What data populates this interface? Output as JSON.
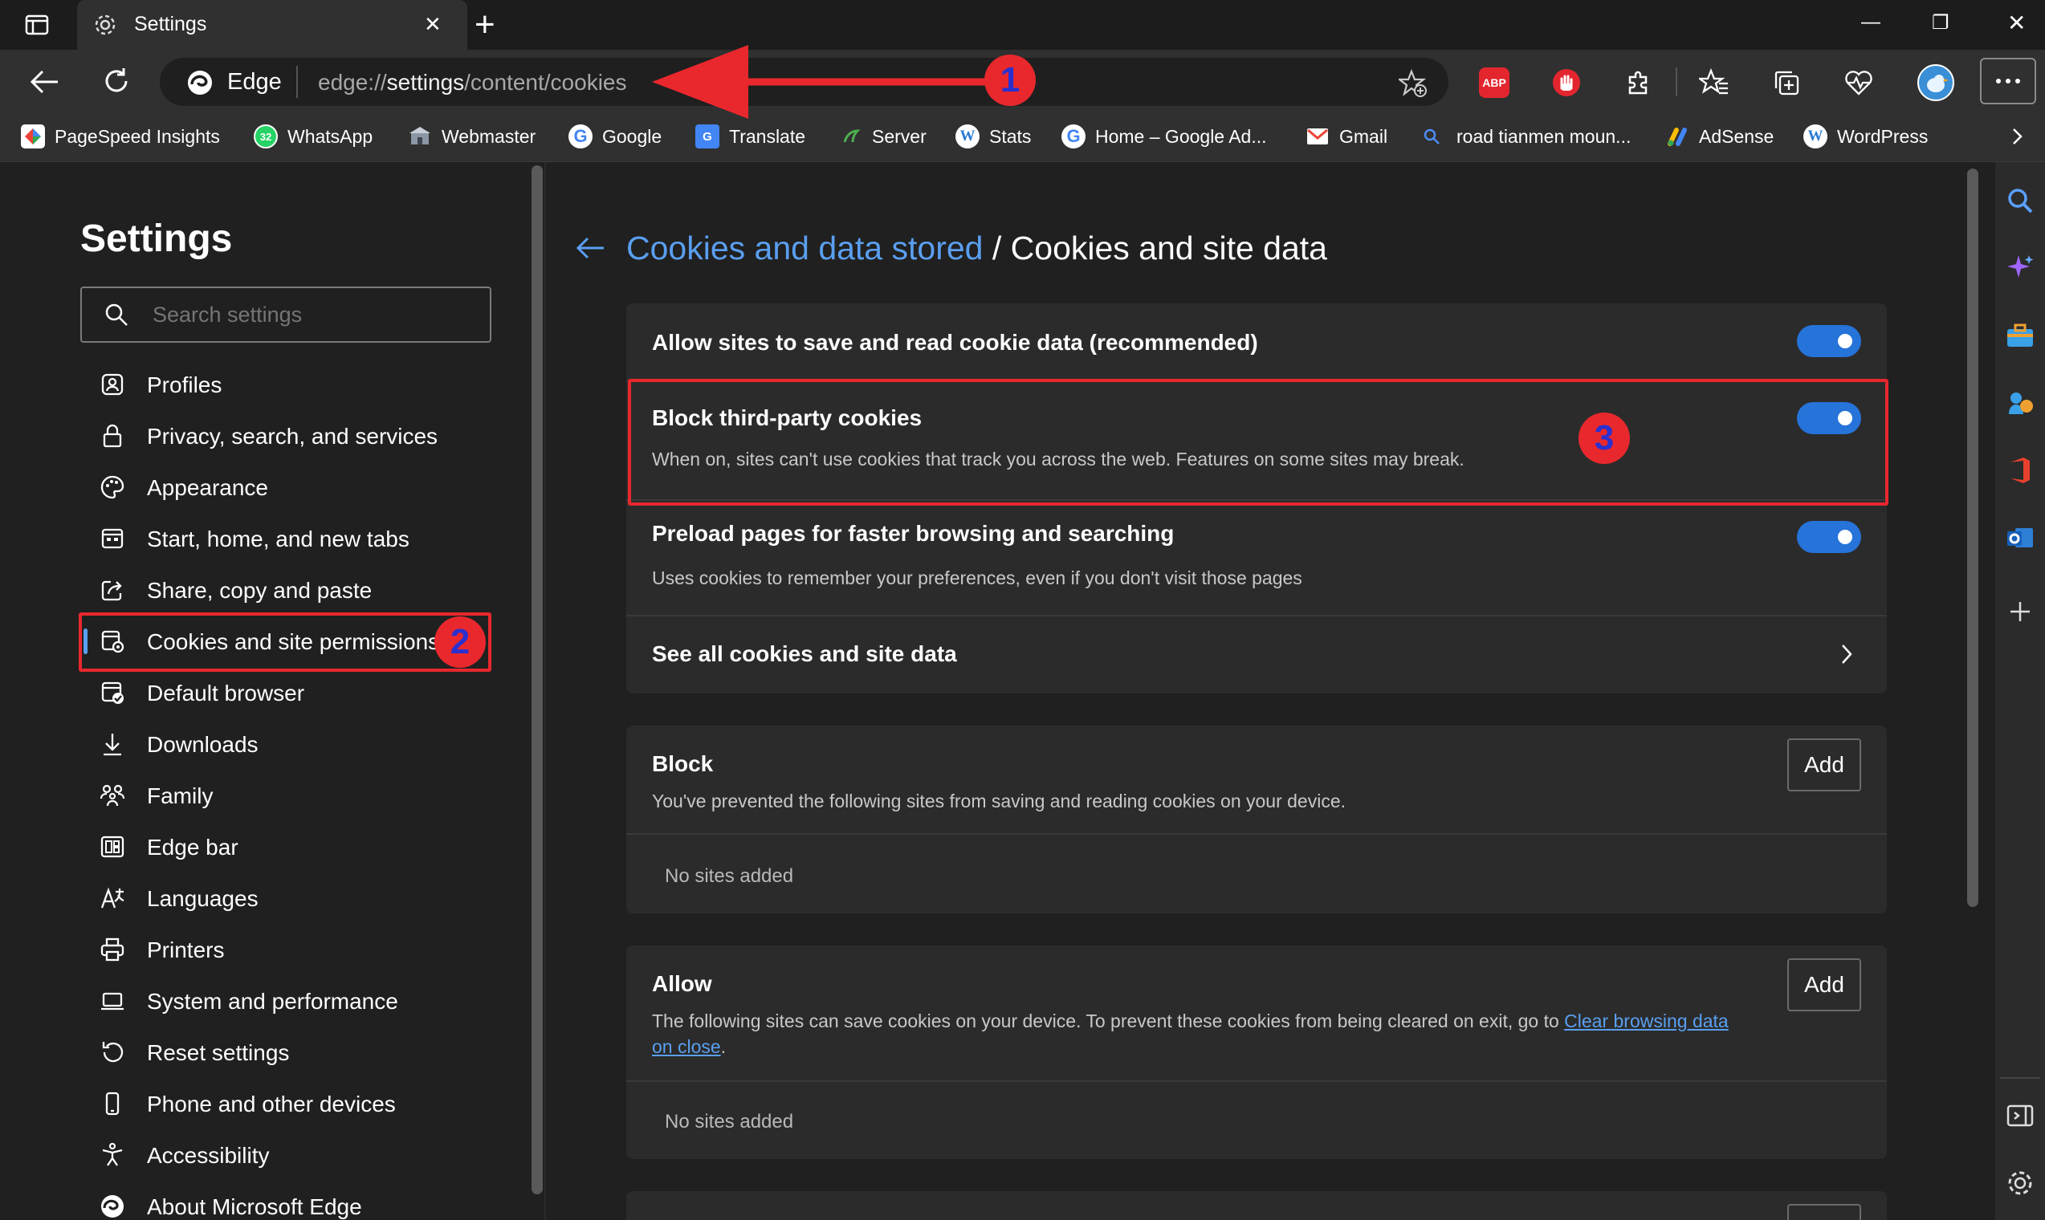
{
  "tab": {
    "title": "Settings",
    "close": "✕",
    "new_tab": "+"
  },
  "window_controls": {
    "minimize": "—",
    "restore": "❐",
    "close": "✕"
  },
  "toolbar": {
    "edge_label": "Edge",
    "url_prefix": "edge://",
    "url_host": "settings",
    "url_path": "/content/cookies",
    "abp_label": "ABP"
  },
  "favorites": [
    {
      "label": "PageSpeed Insights",
      "icon": "pagespeed-icon",
      "color": "#e8453c"
    },
    {
      "label": "WhatsApp",
      "icon": "whatsapp-icon",
      "color": "#25d366",
      "badge": "32"
    },
    {
      "label": "Webmaster",
      "icon": "webmaster-icon",
      "color": "#5f6b7a"
    },
    {
      "label": "Google",
      "icon": "google-icon",
      "color": "#ffffff"
    },
    {
      "label": "Translate",
      "icon": "translate-icon",
      "color": "#4285f4"
    },
    {
      "label": "Server",
      "icon": "server-icon",
      "color": "#2e7d32"
    },
    {
      "label": "Stats",
      "icon": "wordpress-icon",
      "color": "#2a7bd2"
    },
    {
      "label": "Home – Google Ad...",
      "icon": "google-icon",
      "color": "#ffffff"
    },
    {
      "label": "Gmail",
      "icon": "gmail-icon",
      "color": "#ea4335"
    },
    {
      "label": "road tianmen moun...",
      "icon": "search-icon",
      "color": "#4d8df5"
    },
    {
      "label": "AdSense",
      "icon": "adsense-icon",
      "color": "#fbbc04"
    },
    {
      "label": "WordPress",
      "icon": "wordpress-icon",
      "color": "#2a7bd2"
    }
  ],
  "sidebar": {
    "heading": "Settings",
    "search_placeholder": "Search settings",
    "items": [
      {
        "label": "Profiles",
        "icon": "profile-icon"
      },
      {
        "label": "Privacy, search, and services",
        "icon": "lock-icon"
      },
      {
        "label": "Appearance",
        "icon": "palette-icon"
      },
      {
        "label": "Start, home, and new tabs",
        "icon": "start-icon"
      },
      {
        "label": "Share, copy and paste",
        "icon": "share-icon"
      },
      {
        "label": "Cookies and site permissions",
        "icon": "cookie-permissions-icon",
        "selected": true
      },
      {
        "label": "Default browser",
        "icon": "default-browser-icon"
      },
      {
        "label": "Downloads",
        "icon": "download-icon"
      },
      {
        "label": "Family",
        "icon": "family-icon"
      },
      {
        "label": "Edge bar",
        "icon": "edge-bar-icon"
      },
      {
        "label": "Languages",
        "icon": "languages-icon"
      },
      {
        "label": "Printers",
        "icon": "printer-icon"
      },
      {
        "label": "System and performance",
        "icon": "laptop-icon"
      },
      {
        "label": "Reset settings",
        "icon": "reset-icon"
      },
      {
        "label": "Phone and other devices",
        "icon": "phone-icon"
      },
      {
        "label": "Accessibility",
        "icon": "accessibility-icon"
      },
      {
        "label": "About Microsoft Edge",
        "icon": "edge-logo-icon"
      }
    ]
  },
  "breadcrumb": {
    "parent": "Cookies and data stored",
    "separator": " / ",
    "current": "Cookies and site data"
  },
  "settings": {
    "allow_cookies": {
      "title": "Allow sites to save and read cookie data (recommended)",
      "on": true
    },
    "block_third_party": {
      "title": "Block third-party cookies",
      "description": "When on, sites can't use cookies that track you across the web. Features on some sites may break.",
      "on": true
    },
    "preload": {
      "title": "Preload pages for faster browsing and searching",
      "description": "Uses cookies to remember your preferences, even if you don't visit those pages",
      "on": true
    },
    "see_all": {
      "title": "See all cookies and site data"
    }
  },
  "block_section": {
    "title": "Block",
    "description": "You've prevented the following sites from saving and reading cookies on your device.",
    "add_label": "Add",
    "empty": "No sites added"
  },
  "allow_section": {
    "title": "Allow",
    "description_before": "The following sites can save cookies on your device. To prevent these cookies from being cleared on exit, go to ",
    "link_part1": "Clear browsing data",
    "link_part2": "on close",
    "description_after": ".",
    "add_label": "Add",
    "empty": "No sites added"
  },
  "annotations": {
    "badge1": "1",
    "badge2": "2",
    "badge3": "3",
    "color": "#e8282d"
  },
  "accent": "#2673d9"
}
